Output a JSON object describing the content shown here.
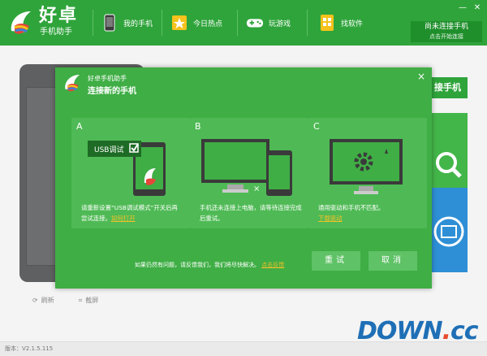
{
  "app": {
    "name": "好卓",
    "subtitle": "手机助手"
  },
  "nav": {
    "items": [
      {
        "label": "我的手机",
        "icon": "phone-icon"
      },
      {
        "label": "今日热点",
        "icon": "star-icon"
      },
      {
        "label": "玩游戏",
        "icon": "gamepad-icon"
      },
      {
        "label": "找软件",
        "icon": "apps-icon"
      }
    ]
  },
  "connect": {
    "title": "尚未连接手机",
    "subtitle": "点击开始连接"
  },
  "background": {
    "panel_title": "接手机",
    "refresh_label": "刷新",
    "screenshot_label": "截屏"
  },
  "dialog": {
    "app_name": "好卓手机助手",
    "title": "连接新的手机",
    "close": "×",
    "cards": [
      {
        "letter": "A",
        "badge_text": "USB调试",
        "desc": "请重新设置“USB调试模式”开关后再尝试连接。",
        "link": "如何打开"
      },
      {
        "letter": "B",
        "desc": "手机还未连接上电脑，请等待连接完成后重试。",
        "link": ""
      },
      {
        "letter": "C",
        "desc": "通用驱动和手机不匹配。",
        "link": "下载驱动"
      }
    ],
    "footer_text": "如果仍然有问题，请反馈我们，我们将尽快解决。",
    "footer_link": "点击反馈",
    "retry_label": "重试",
    "cancel_label": "取消"
  },
  "status": {
    "version": "版本：V2.1.5.115"
  },
  "watermark": {
    "main": "DOWN",
    "dot": ".",
    "suffix": "cc"
  },
  "colors": {
    "brand": "#2fa43b",
    "dialog_bg": "#3fae45",
    "card_bg": "#4fba55",
    "link": "#f2c028"
  }
}
